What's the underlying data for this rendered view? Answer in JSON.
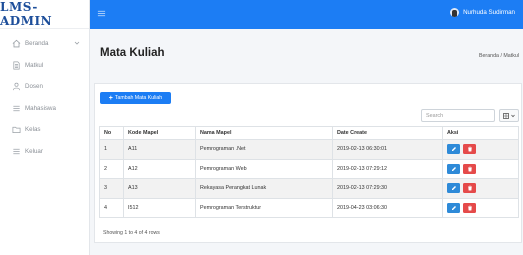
{
  "brand": "LMS-ADMIN",
  "sidebar": {
    "items": [
      {
        "label": "Beranda",
        "icon": "home-icon"
      },
      {
        "label": "Matkul",
        "icon": "document-icon"
      },
      {
        "label": "Dosen",
        "icon": "users-icon"
      },
      {
        "label": "Mahasiswa",
        "icon": "list-icon"
      },
      {
        "label": "Kelas",
        "icon": "folder-icon"
      },
      {
        "label": "Keluar",
        "icon": "list-icon"
      }
    ]
  },
  "topbar": {
    "user_name": "Nurhuda Sudirman",
    "color": "#1c7df4"
  },
  "page": {
    "title": "Mata Kuliah",
    "breadcrumb": "Beranda / Matkul"
  },
  "toolbar": {
    "add_label": "Tambah Mata Kuliah",
    "search_placeholder": "Search"
  },
  "table": {
    "headers": [
      "No",
      "Kode Mapel",
      "Nama Mapel",
      "Date Create",
      "Aksi"
    ],
    "rows": [
      [
        "1",
        "A11",
        "Pemrograman .Net",
        "2019-02-13 06:30:01"
      ],
      [
        "2",
        "A12",
        "Pemrograman Web",
        "2019-02-13 07:29:12"
      ],
      [
        "3",
        "A13",
        "Rekayasa Perangkat Lunak",
        "2019-02-13 07:29:30"
      ],
      [
        "4",
        "I512",
        "Pemrograman Terstruktur",
        "2019-04-23 03:06:30"
      ]
    ]
  },
  "footer": {
    "summary": "Showing 1 to 4 of 4 rows"
  }
}
